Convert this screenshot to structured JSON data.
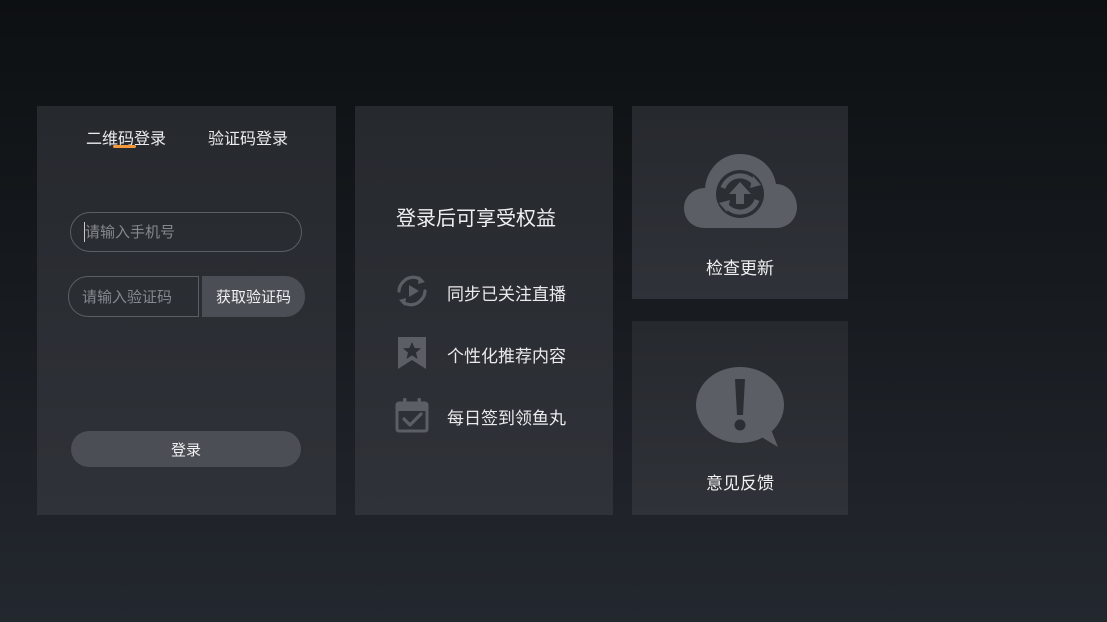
{
  "login": {
    "tabs": [
      {
        "label": "二维码登录",
        "active": true
      },
      {
        "label": "验证码登录",
        "active": false
      }
    ],
    "phone_placeholder": "请输入手机号",
    "code_placeholder": "请输入验证码",
    "get_code_label": "获取验证码",
    "submit_label": "登录"
  },
  "benefits": {
    "title": "登录后可享受权益",
    "items": [
      {
        "label": "同步已关注直播",
        "icon": "sync-play-icon"
      },
      {
        "label": "个性化推荐内容",
        "icon": "bookmark-star-icon"
      },
      {
        "label": "每日签到领鱼丸",
        "icon": "calendar-check-icon"
      }
    ]
  },
  "tiles": {
    "update": {
      "label": "检查更新",
      "icon": "cloud-update-icon"
    },
    "feedback": {
      "label": "意见反馈",
      "icon": "feedback-exclamation-icon"
    }
  },
  "colors": {
    "accent": "#f3993a",
    "panel": "#2b2e33",
    "button": "#4b4e55",
    "icon": "#5b5e65"
  }
}
